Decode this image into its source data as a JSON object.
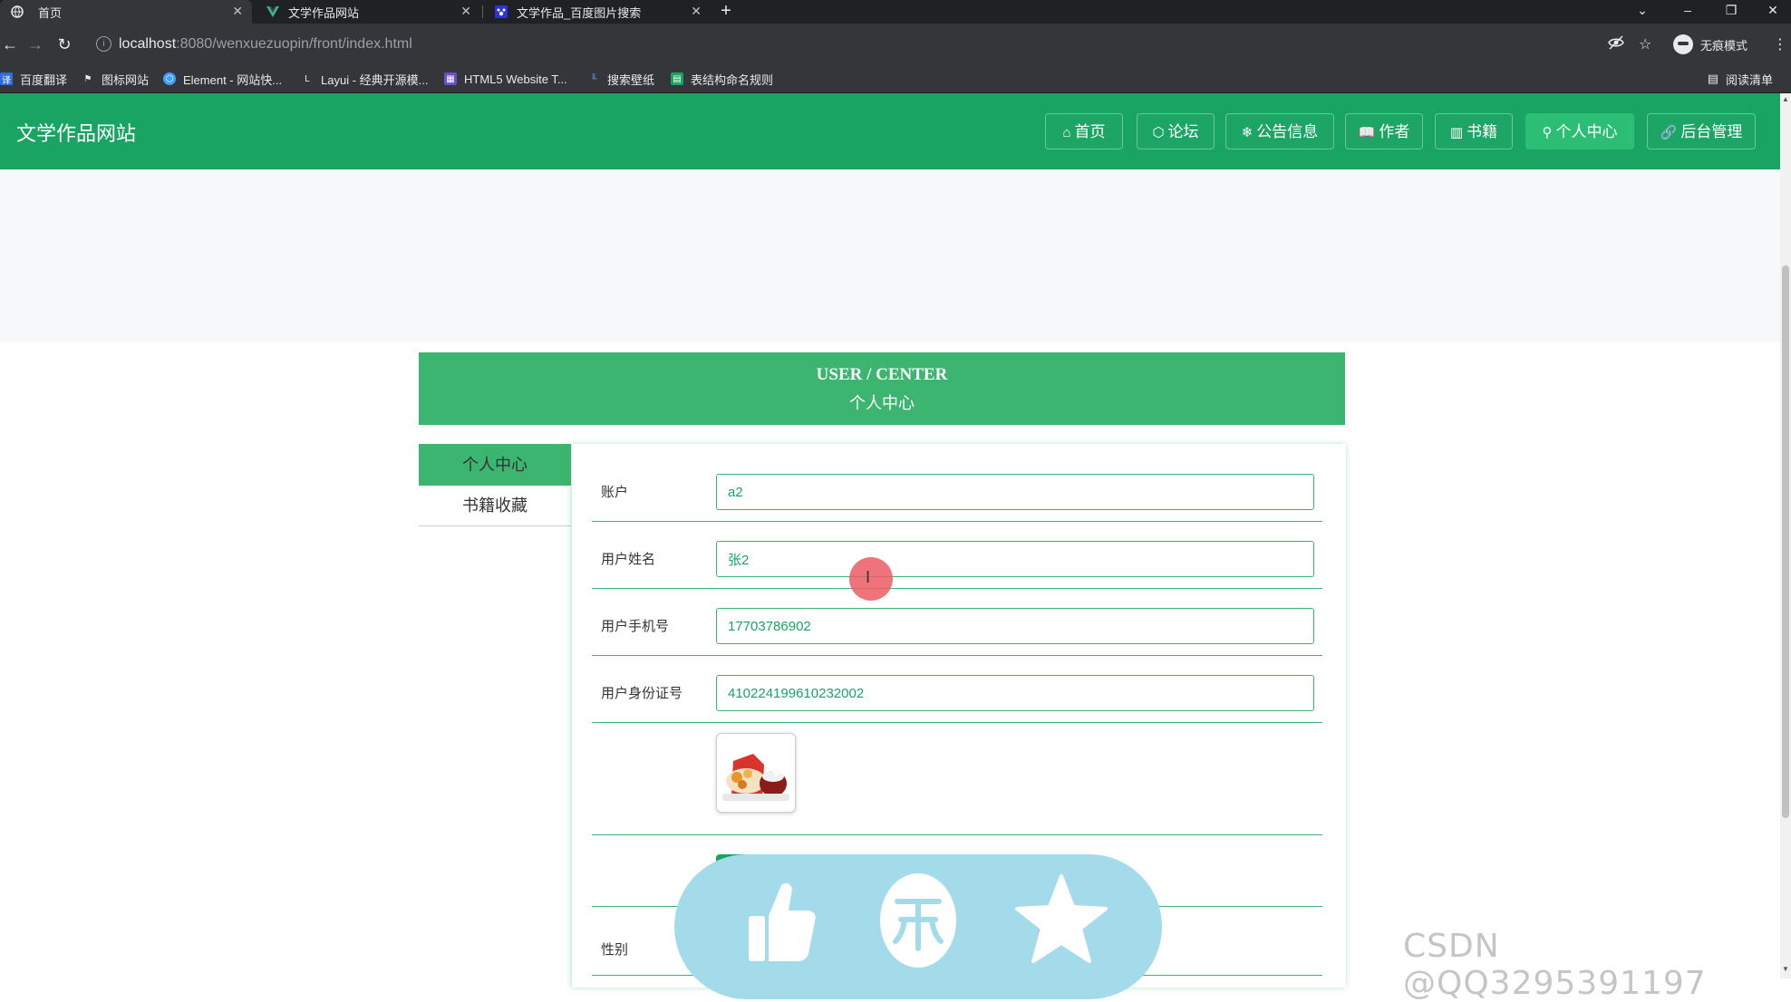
{
  "browser": {
    "tabs": [
      {
        "title": "首页",
        "active": true
      },
      {
        "title": "文学作品网站",
        "active": false
      },
      {
        "title": "文学作品_百度图片搜索",
        "active": false
      }
    ],
    "url_host": "localhost",
    "url_rest": ":8080/wenxuezuopin/front/index.html",
    "bookmarks": [
      "百度翻译",
      "图标网站",
      "Element - 网站快...",
      "Layui - 经典开源模...",
      "HTML5 Website T...",
      "搜索壁纸",
      "表结构命名规则"
    ],
    "reading_list": "阅读清单",
    "profile": "无痕模式"
  },
  "site": {
    "title": "文学作品网站",
    "nav": [
      {
        "label": "首页",
        "icon": "home-icon"
      },
      {
        "label": "论坛",
        "icon": "forum-icon"
      },
      {
        "label": "公告信息",
        "icon": "notice-icon"
      },
      {
        "label": "作者",
        "icon": "author-icon"
      },
      {
        "label": "书籍",
        "icon": "book-icon"
      },
      {
        "label": "个人中心",
        "icon": "user-icon",
        "active": true
      },
      {
        "label": "后台管理",
        "icon": "link-icon"
      }
    ]
  },
  "user_center": {
    "title_en": "USER / CENTER",
    "title_cn": "个人中心",
    "menu": [
      {
        "label": "个人中心",
        "active": true
      },
      {
        "label": "书籍收藏",
        "active": false
      }
    ],
    "fields": {
      "account": {
        "label": "账户",
        "value": "a2"
      },
      "name": {
        "label": "用户姓名",
        "value": "张2"
      },
      "phone": {
        "label": "用户手机号",
        "value": "17703786902"
      },
      "id_card": {
        "label": "用户身份证号",
        "value": "410224199610232002"
      },
      "gender": {
        "label": "性别"
      }
    }
  },
  "overlay": {
    "icons": [
      "thumbs-up-icon",
      "coin-icon",
      "star-icon"
    ],
    "color": "#a3dbeb"
  },
  "watermark": "CSDN @QQ3295391197",
  "colors": {
    "brand": "#19a463",
    "accent": "#3bb56f"
  }
}
